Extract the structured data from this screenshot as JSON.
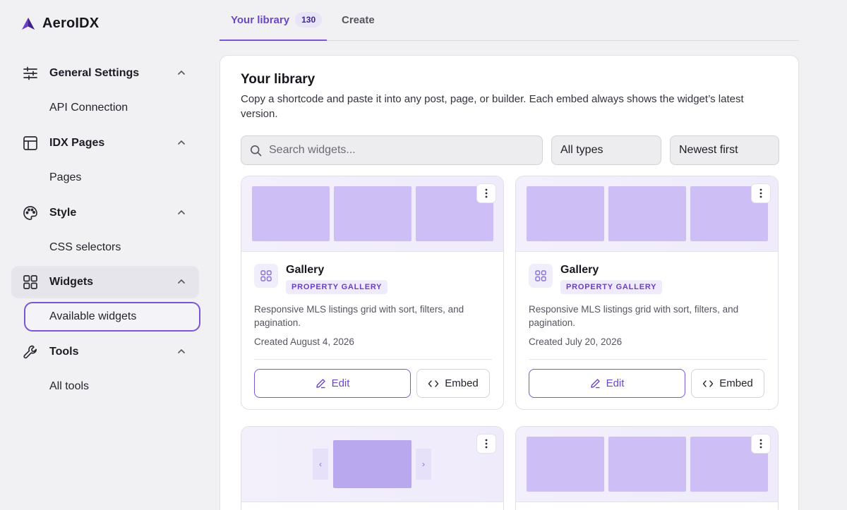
{
  "app": {
    "name": "AeroIDX"
  },
  "sidebar": {
    "groups": [
      {
        "label": "General Settings",
        "icon": "sliders-icon",
        "sub": "API Connection"
      },
      {
        "label": "IDX Pages",
        "icon": "layout-icon",
        "sub": "Pages"
      },
      {
        "label": "Style",
        "icon": "palette-icon",
        "sub": "CSS selectors"
      },
      {
        "label": "Widgets",
        "icon": "grid-icon",
        "sub": "Available widgets"
      },
      {
        "label": "Tools",
        "icon": "wrench-icon",
        "sub": "All tools"
      }
    ]
  },
  "tabs": {
    "library_label": "Your library",
    "library_count": "130",
    "create_label": "Create"
  },
  "library": {
    "title": "Your library",
    "description": "Copy a shortcode and paste it into any post, page, or builder. Each embed always shows the widget’s latest version.",
    "search_placeholder": "Search widgets...",
    "type_filter": "All types",
    "sort": "Newest first"
  },
  "cards": [
    {
      "name": "Gallery",
      "tag": "PROPERTY GALLERY",
      "description": "Responsive MLS listings grid with sort, filters, and pagination.",
      "created": "Created August 4, 2026",
      "edit_label": "Edit",
      "embed_label": "Embed"
    },
    {
      "name": "Gallery",
      "tag": "PROPERTY GALLERY",
      "description": "Responsive MLS listings grid with sort, filters, and pagination.",
      "created": "Created July 20, 2026",
      "edit_label": "Edit",
      "embed_label": "Embed"
    }
  ],
  "colors": {
    "accent": "#7a55d8",
    "accent_text": "#6a47c8",
    "tile": "#cdbff5",
    "tag_bg": "#f0ebfc"
  }
}
